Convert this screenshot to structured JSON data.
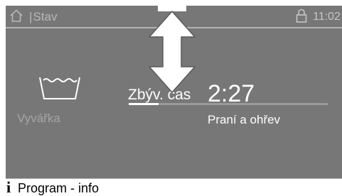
{
  "status_bar": {
    "separator": "|",
    "title": "Stav",
    "time": "11:02",
    "icons": [
      "home-icon",
      "lock-icon"
    ]
  },
  "device": {
    "icon": "washtub-icon",
    "label": "Vyvářka"
  },
  "program": {
    "remaining_label": "Zbýv. čas",
    "remaining_value": "2:27",
    "progress_fraction": 0.15,
    "phase": "Praní a ohřev"
  },
  "info_bar": {
    "icon": "info-icon",
    "icon_glyph": "i",
    "label": "Program - info"
  },
  "gesture": {
    "icon": "vertical-swipe-arrow-icon"
  },
  "colors": {
    "screen_background": "#777777",
    "text_primary": "#ffffff",
    "text_dimmed": "#a5a5a5",
    "info_bar_background": "#ffffff"
  }
}
